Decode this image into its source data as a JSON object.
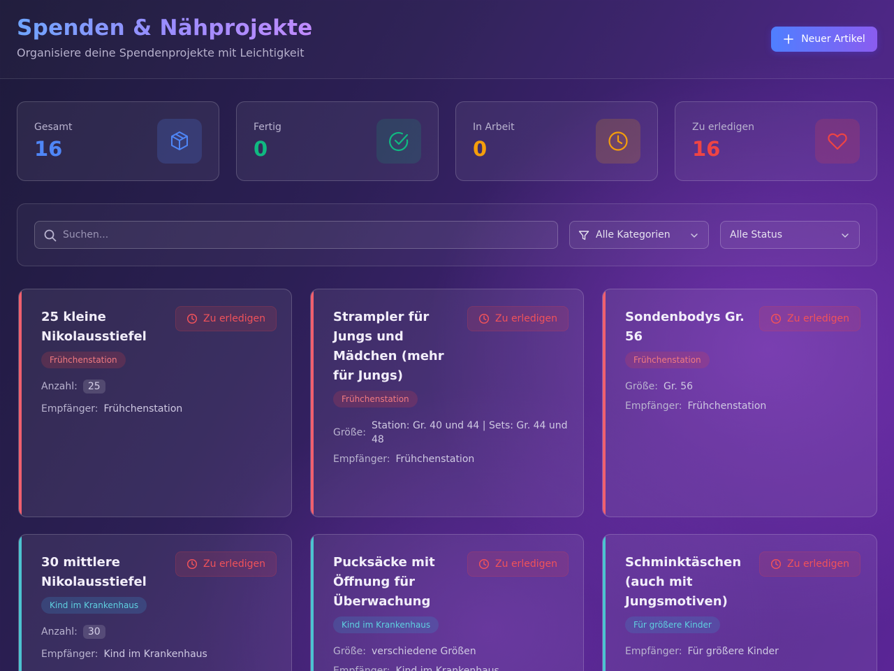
{
  "header": {
    "title": "Spenden & Nähprojekte",
    "subtitle": "Organisiere deine Spendenprojekte mit Leichtigkeit",
    "new_button_label": "Neuer Artikel"
  },
  "stats": [
    {
      "label": "Gesamt",
      "value": "16",
      "color": "#4f86f7",
      "icon": "box-icon"
    },
    {
      "label": "Fertig",
      "value": "0",
      "color": "#10b981",
      "icon": "check-circle-icon"
    },
    {
      "label": "In Arbeit",
      "value": "0",
      "color": "#f59e0b",
      "icon": "clock-icon"
    },
    {
      "label": "Zu erledigen",
      "value": "16",
      "color": "#ef4444",
      "icon": "heart-icon"
    }
  ],
  "filters": {
    "search_placeholder": "Suchen...",
    "category_selected": "Alle Kategorien",
    "status_selected": "Alle Status"
  },
  "labels": {
    "anzahl": "Anzahl:",
    "groesse": "Größe:",
    "empfaenger": "Empfänger:"
  },
  "cards": [
    {
      "title": "25 kleine Nikolausstiefel",
      "status": "Zu erledigen",
      "category": "Frühchenstation",
      "anzahl": "25",
      "empfaenger": "Frühchenstation"
    },
    {
      "title": "Strampler für Jungs und Mädchen (mehr für Jungs)",
      "status": "Zu erledigen",
      "category": "Frühchenstation",
      "groesse": "Station: Gr. 40 und 44 | Sets: Gr. 44 und 48",
      "empfaenger": "Frühchenstation"
    },
    {
      "title": "Sondenbodys Gr. 56",
      "status": "Zu erledigen",
      "category": "Frühchenstation",
      "groesse": "Gr. 56",
      "empfaenger": "Frühchenstation"
    },
    {
      "title": "30 mittlere Nikolausstiefel",
      "status": "Zu erledigen",
      "category": "Kind im Krankenhaus",
      "anzahl": "30",
      "empfaenger": "Kind im Krankenhaus"
    },
    {
      "title": "Pucksäcke mit Öffnung für Überwachung",
      "status": "Zu erledigen",
      "category": "Kind im Krankenhaus",
      "groesse": "verschiedene Größen",
      "empfaenger": "Kind im Krankenhaus"
    },
    {
      "title": "Schminktäschen (auch mit Jungsmotiven)",
      "status": "Zu erledigen",
      "category": "Für größere Kinder",
      "empfaenger": "Für größere Kinder"
    }
  ],
  "colors": {
    "accent_red": "#f0606e",
    "accent_teal": "#4cc3d0"
  }
}
